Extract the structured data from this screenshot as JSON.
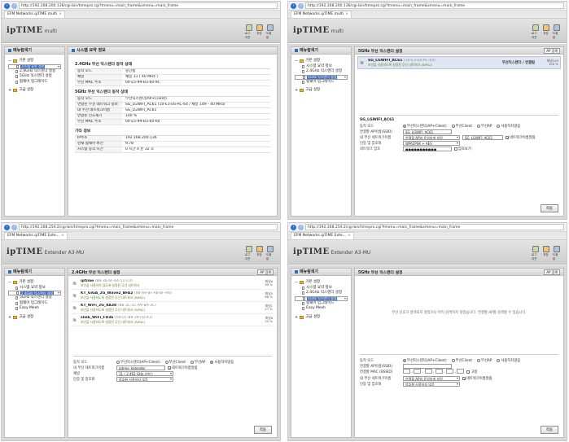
{
  "panels": [
    {
      "url": "http://192.168.200.136/cgi-bin/timepro.cgi?tmenu=main_frame&smenu=main_frame",
      "tab": "EFM Networks ipTIME multi",
      "logo_sub": "multi",
      "header_icons": [
        "로그아웃",
        "저장",
        "도움말"
      ],
      "sidebar": {
        "title": "메뉴탐색기",
        "group1": "기본 설정",
        "items": [
          "시스템 요약 정보",
          "2.4GHz 익스텐더 설정",
          "5GHz 익스텐더 설정",
          "펌웨어 업그레이드"
        ],
        "selected": 0,
        "group2": "고급 설정"
      },
      "main": {
        "title": "시스템 요약 정보",
        "sections": [
          {
            "title": "2.4GHz 무선 익스텐더 동작 상태",
            "rows": [
              [
                "동작 모드",
                "중단됨"
              ],
              [
                "채널",
                "채널 11 ( 40 MHz )"
              ],
              [
                "무선 MAC 주소",
                "04-E5-99-B3-64-9C"
              ]
            ]
          },
          {
            "title": "5GHz 무선 익스텐더 동작 상태",
            "rows": [
              [
                "동작 모드",
                "무선익스텐더(AP+Client)"
              ],
              [
                "연결된 무선 네트워크 정보",
                "SG_LGWIFI_AC61 (10-E3-E6-AC-64 / 채널 149 - 40 MHz)"
              ],
              [
                "내 무선 네트워크이름",
                "SG_LGWIFI_AC61"
              ],
              [
                "연결된 신호세기",
                "100 %"
              ],
              [
                "무선 MAC 주소",
                "04-E5-99-B3-64-60"
              ]
            ]
          },
          {
            "title": "기타 정보",
            "rows": [
              [
                "IP주소",
                "192.168.200.136"
              ],
              [
                "현재 펌웨어 버전",
                "9.78"
              ],
              [
                "시스템 동작 시간",
                "0 시간 0 분 32 초"
              ]
            ]
          }
        ]
      }
    },
    {
      "url": "http://192.168.200.136/cgi-bin/timepro.cgi?tmenu=main_frame&smenu=main_frame",
      "tab": "EFM Networks ipTIME multi",
      "logo_sub": "multi",
      "header_icons": [
        "로그아웃",
        "저장",
        "도움말"
      ],
      "sidebar": {
        "title": "메뉴탐색기",
        "group1": "기본 설정",
        "items": [
          "시스템 요약 정보",
          "2.4GHz 익스텐더 설정",
          "5GHz 익스텐더 설정",
          "펌웨어 업그레이드"
        ],
        "selected": 2,
        "group2": "고급 설정"
      },
      "main": {
        "title": "5GHz 무선 익스텐더 설정",
        "scan_button": "AP 검색",
        "aps": [
          {
            "name": "SG_LGWIFI_AC61",
            "mac": "(10-E3-E6-AC-64)",
            "security": "보안을 사용하도록 설정된 무선 네트워크 (WPA2)",
            "status": "무선익스텐더 / 연결됨",
            "channel": "채널149",
            "signal": "100 %"
          }
        ],
        "ssid_title": "SG_LGWIFI_AC61",
        "mode_label": "동작 모드",
        "modes": [
          "무선익스텐더(AP+Client)",
          "무선Client",
          "무선AP",
          "사용하지않음"
        ],
        "mode_selected": 0,
        "fields": [
          {
            "label": "연결할 AP이름(SSID)",
            "value": "SG_LGWIFI_AC61"
          },
          {
            "label": "내 무선 네트워크이름",
            "value": "연결할 AP와 동일하게 설정",
            "extra": "SG_LGWIFI_AC61",
            "check": "네트워크이름알림"
          },
          {
            "label": "인증 및 암호화",
            "value": "WPA2PSK + AES"
          },
          {
            "label": "네트워크 암호",
            "value": "●●●●●●●●●●●",
            "check": "암호보기"
          }
        ],
        "apply": "적용"
      }
    },
    {
      "url": "http://192.168.254.2/cgi-bin/timepro.cgi?tmenu=main_frame&smenu=main_frame",
      "tab": "EFM Networks ipTIME Exte...",
      "logo_sub": "Extender A3-MU",
      "header_icons": [
        "로그아웃",
        "저장",
        "도움말"
      ],
      "sidebar": {
        "title": "메뉴탐색기",
        "group1": "기본 설정",
        "items": [
          "시스템 요약 정보",
          "2.4GHz 익스텐더 설정",
          "5GHz 익스텐더 설정",
          "펌웨어 업그레이드",
          "Easy Mesh"
        ],
        "selected": 1,
        "group2": "고급 설정"
      },
      "main": {
        "title": "2.4GHz 무선 익스텐더 설정",
        "scan_button": "AP 검색",
        "aps": [
          {
            "name": "iptime",
            "mac": "(88-36-6F-64-51-C0)",
            "security": "보안을 사용하지 않도록 설정된 무선 네트워크",
            "status": "",
            "channel": "채널6",
            "signal": "99 %"
          },
          {
            "name": "KT_GiGA_2G_Wave2_BFA2",
            "mac": "(88-A9-8F-A8-BF-A4)",
            "security": "보안을 사용하도록 설정된 무선 네트워크 (WPA2)",
            "status": "",
            "channel": "채널5",
            "signal": "68 %"
          },
          {
            "name": "KT_WiFi_2G_8A38",
            "mac": "(88-3C-1C-A9-8A-3C)",
            "security": "보안을 사용하도록 설정된 무선 네트워크 (WPA2)",
            "status": "",
            "channel": "채널1",
            "signal": "27 %"
          },
          {
            "name": "sliek_WiFi_FD3E",
            "mac": "(00-07-89-39-FD-41)",
            "security": "보안을 사용하도록 설정된 무선 네트워크 (WPA2)",
            "status": "",
            "channel": "채널6",
            "signal": "24 %"
          }
        ],
        "mode_label": "동작 모드",
        "modes": [
          "무선익스텐더(AP+Client)",
          "무선Client",
          "무선AP",
          "사용하지않음"
        ],
        "mode_selected": 3,
        "fields": [
          {
            "label": "내 무선 네트워크이름",
            "value": "iptime_extender",
            "check": "네트워크이름알림"
          },
          {
            "label": "채널",
            "value": "11 ( 2.462 GHz,상위 )"
          },
          {
            "label": "인증 및 암호화",
            "value": "암호화 사용하지 않음"
          }
        ],
        "apply": "적용"
      }
    },
    {
      "url": "http://192.168.254.2/cgi-bin/timepro.cgi?tmenu=main_frame&smenu=main_frame",
      "tab": "EFM Networks ipTIME Exte...",
      "logo_sub": "Extender A3-MU",
      "header_icons": [
        "로그아웃",
        "저장",
        "도움말"
      ],
      "sidebar": {
        "title": "메뉴탐색기",
        "group1": "기본 설정",
        "items": [
          "시스템 요약 정보",
          "2.4GHz 익스텐더 설정",
          "5GHz 익스텐더 설정",
          "펌웨어 업그레이드",
          "Easy Mesh"
        ],
        "selected": 2,
        "group2": "고급 설정"
      },
      "main": {
        "title": "5GHz 무선 익스텐더 설정",
        "scan_button": "AP 검색",
        "no_result": "무선 신호가 검색되지 않았거나 아직 검색하지 않았습니다. 연결할 AP를 검색할 수 있습니다.",
        "mode_label": "동작 모드",
        "modes": [
          "무선익스텐더(AP+Client)",
          "무선Client",
          "무선AP",
          "사용하지않음"
        ],
        "mode_selected": 0,
        "fields": [
          {
            "label": "연결할 AP이름(SSID)",
            "value": ""
          },
          {
            "label": "연결할 MAC (BSSID)",
            "value": "",
            "check": "고정"
          },
          {
            "label": "내 무선 네트워크이름",
            "value": "연결할 AP와 동일하게 설정",
            "check": "네트워크이름알림"
          },
          {
            "label": "인증 및 암호화",
            "value": "암호화 사용하지 않음"
          }
        ],
        "apply": "적용"
      }
    }
  ],
  "logo_brand": "ipTIME"
}
